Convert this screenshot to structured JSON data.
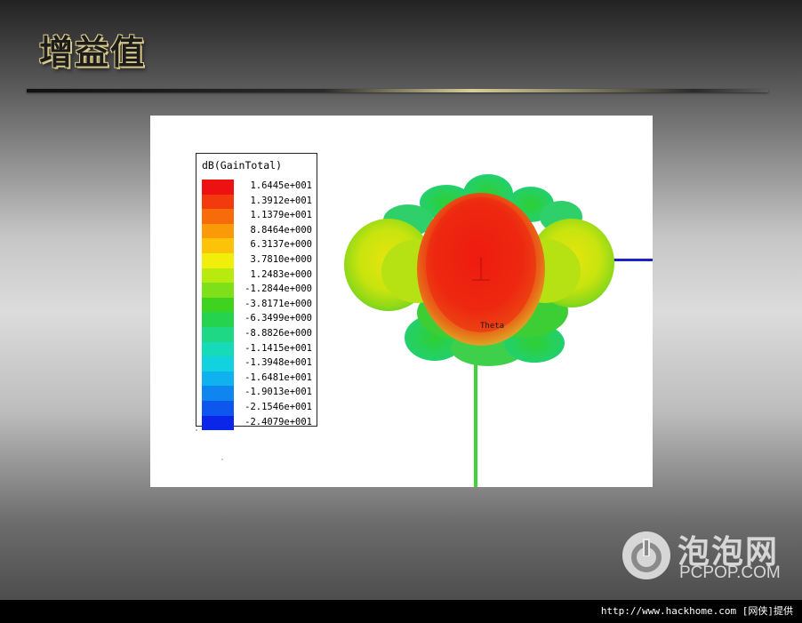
{
  "slide": {
    "title": "增益值"
  },
  "plot": {
    "legend": {
      "title": "dB(GainTotal)",
      "entries": [
        {
          "label": "1.6445e+001",
          "color": "#ee1111"
        },
        {
          "label": "1.3912e+001",
          "color": "#f23a0c"
        },
        {
          "label": "1.1379e+001",
          "color": "#f76b0a"
        },
        {
          "label": "8.8464e+000",
          "color": "#fb9a08"
        },
        {
          "label": "6.3137e+000",
          "color": "#fcc308"
        },
        {
          "label": "3.7810e+000",
          "color": "#f2ee0c"
        },
        {
          "label": "1.2483e+000",
          "color": "#b8ea10"
        },
        {
          "label": "-1.2844e+000",
          "color": "#7ee018"
        },
        {
          "label": "-3.8171e+000",
          "color": "#3fd21f"
        },
        {
          "label": "-6.3499e+000",
          "color": "#26d34f"
        },
        {
          "label": "-8.8826e+000",
          "color": "#1fd886"
        },
        {
          "label": "-1.1415e+001",
          "color": "#17dbb8"
        },
        {
          "label": "-1.3948e+001",
          "color": "#12d2e0"
        },
        {
          "label": "-1.6481e+001",
          "color": "#0fb2ee"
        },
        {
          "label": "-1.9013e+001",
          "color": "#0f85f0"
        },
        {
          "label": "-2.1546e+001",
          "color": "#0d57ef"
        },
        {
          "label": "-2.4079e+001",
          "color": "#0b26e8"
        }
      ]
    },
    "axis_label": "Theta"
  },
  "watermark": {
    "name_cn": "泡泡网",
    "name_en": "PCPOP.COM",
    "icon": "power-icon"
  },
  "footer": {
    "credit": "http://www.hackhome.com [网侠]提供"
  }
}
